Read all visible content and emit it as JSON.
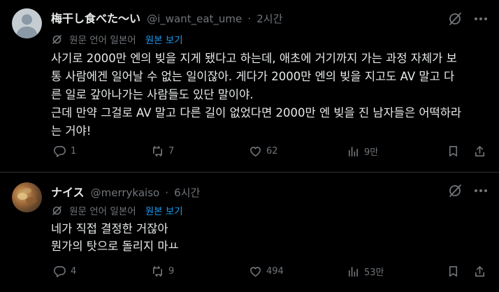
{
  "tweets": [
    {
      "display_name": "梅干し食べた〜い",
      "handle": "@i_want_eat_ume",
      "separator": "·",
      "time": "2시간",
      "translated_label": "원문 언어 일본어",
      "show_original": "원본 보기",
      "lines": [
        "사기로 2000만 엔의 빚을 지게 됐다고 하는데, 애초에 거기까지 가는 과정 자체가 보",
        "통 사람에겐 일어날 수 없는 일이잖아. 게다가 2000만 엔의 빚을 지고도 AV 말고 다",
        "른 일로 갚아나가는 사람들도 있단 말이야.",
        "근데 만약 그걸로 AV 말고 다른 길이 없었다면 2000만 엔 빚을 진 남자들은 어떡하라",
        "는 거야!"
      ],
      "replies": "1",
      "reposts": "7",
      "likes": "62",
      "views": "9만"
    },
    {
      "display_name": "ナイス",
      "handle": "@merrykaiso",
      "separator": "·",
      "time": "6시간",
      "translated_label": "원문 언어 일본어",
      "show_original": "원본 보기",
      "lines": [
        "네가 직접 결정한 거잖아",
        "뭔가의 탓으로 돌리지 마ㅛ"
      ],
      "replies": "4",
      "reposts": "9",
      "likes": "494",
      "views": "53만"
    }
  ],
  "colors": {
    "background": "#000000",
    "text": "#e7e9ea",
    "secondary": "#71767b",
    "link": "#1d9bf0",
    "divider": "#2f3336"
  }
}
